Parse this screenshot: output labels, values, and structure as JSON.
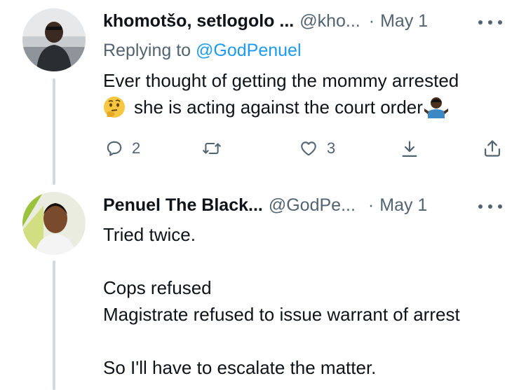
{
  "tweet1": {
    "display_name": "khomotšo, setlogolo ...",
    "handle": "@kho...",
    "date": "May 1",
    "replying_prefix": "Replying to",
    "replying_handle": "@GodPenuel",
    "text_line1": "Ever thought of getting the mommy arrested",
    "text_line2": "she is acting against the court order",
    "actions": {
      "reply_count": "2",
      "like_count": "3"
    },
    "icons": [
      "more-dots-icon",
      "thinking-face-emoji",
      "person-shrugging-emoji",
      "reply-icon",
      "retweet-icon",
      "like-icon",
      "share-icon",
      "upload-icon"
    ]
  },
  "tweet2": {
    "display_name": "Penuel The Black...",
    "handle": "@GodPe...",
    "date": "May 1",
    "lines": [
      "Tried twice.",
      "",
      "Cops refused",
      "Magistrate refused to issue warrant of arrest",
      "",
      "So I'll have to escalate the matter."
    ]
  },
  "colors": {
    "secondary_text": "#536471",
    "link": "#1d9bf0",
    "thread_line": "#cfd9de"
  }
}
